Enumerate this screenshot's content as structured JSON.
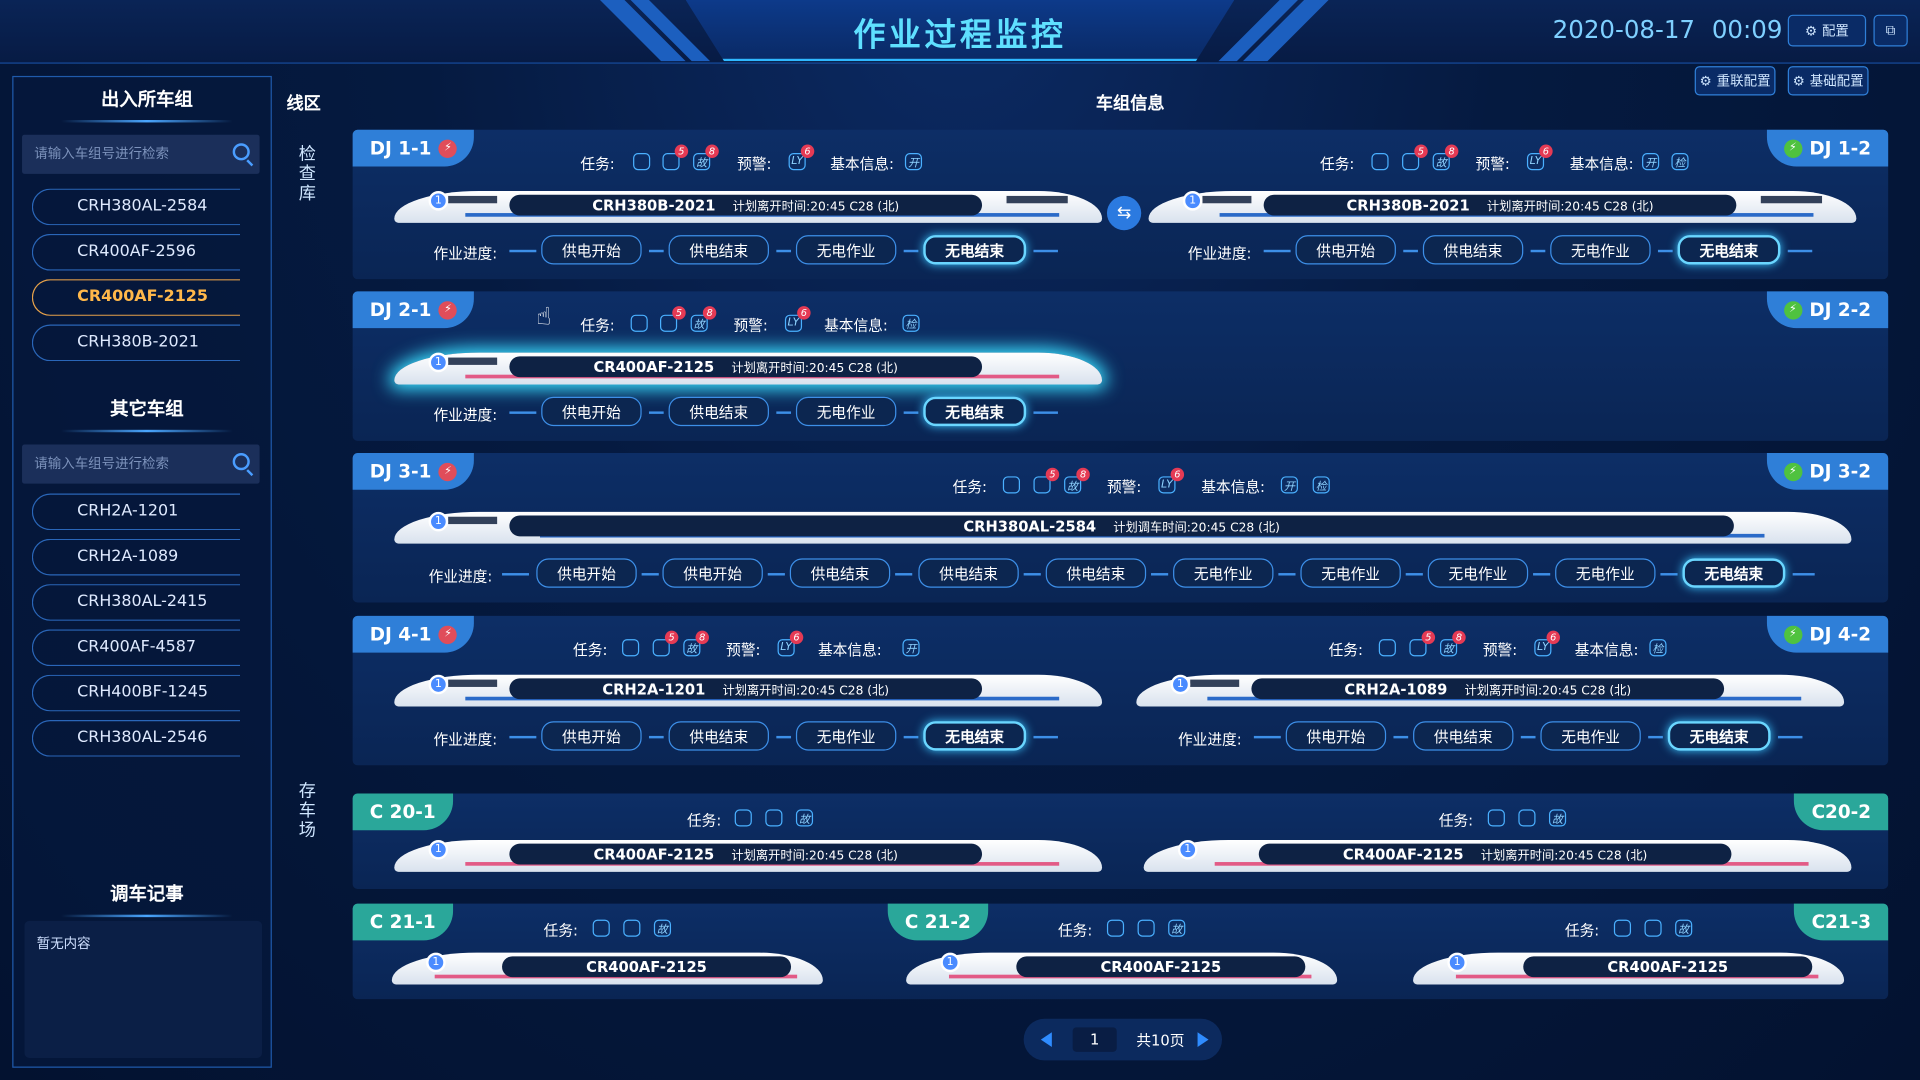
{
  "header": {
    "title": "作业过程监控",
    "date": "2020-08-17",
    "time": "00:09",
    "config": "配置",
    "reset_config": "重联配置",
    "base_config": "基础配置"
  },
  "left": {
    "in_out_title": "出入所车组",
    "search_placeholder": "请输入车组号进行检索",
    "in_out_list": [
      "CRH380AL-2584",
      "CR400AF-2596",
      "CR400AF-2125",
      "CRH380B-2021"
    ],
    "other_title": "其它车组",
    "other_list": [
      "CRH2A-1201",
      "CRH2A-1089",
      "CRH380AL-2415",
      "CR400AF-4587",
      "CRH400BF-1245",
      "CRH380AL-2546"
    ],
    "memo_title": "调车记事",
    "memo_content": "暂无内容"
  },
  "columns": {
    "zone": "线区",
    "info": "车组信息",
    "inspect": "检查库",
    "storage": "存车场"
  },
  "labels": {
    "task": "任务:",
    "warn": "预警:",
    "basic": "基本信息:",
    "progress": "作业进度:",
    "plan_leave": "计划离开时间:",
    "plan_shunt": "计划调车时间:",
    "time": "20:45 C28 (北)",
    "i_fault": "故",
    "i_warn": "LY",
    "i_open": "开",
    "i_check": "检",
    "b5": "5",
    "b8": "8",
    "b6": "6",
    "one": "1"
  },
  "rows": [
    {
      "left": "DJ 1-1",
      "right": "DJ 1-2",
      "train_l": "CRH380B-2021",
      "train_r": "CRH380B-2021"
    },
    {
      "left": "DJ 2-1",
      "right": "DJ 2-2",
      "train_l": "CR400AF-2125"
    },
    {
      "left": "DJ 3-1",
      "right": "DJ 3-2",
      "train_l": "CRH380AL-2584"
    },
    {
      "left": "DJ 4-1",
      "right": "DJ 4-2",
      "train_l": "CRH2A-1201",
      "train_r": "CRH2A-1089"
    },
    {
      "left": "C 20-1",
      "right": "C20-2",
      "train_l": "CR400AF-2125",
      "train_r": "CR400AF-2125"
    },
    {
      "left": "C 21-1",
      "mid": "C 21-2",
      "right": "C21-3",
      "t1": "CR400AF-2125",
      "t2": "CR400AF-2125",
      "t3": "CR400AF-2125"
    }
  ],
  "steps": {
    "s1": "供电开始",
    "s2": "供电结束",
    "s3": "无电作业",
    "s4": "无电结束"
  },
  "pager": {
    "page": "1",
    "total": "共10页"
  },
  "colors": {
    "accent": "#5fe0ff",
    "panel": "#0a2554",
    "tag_blue": "#2f7fd8",
    "tag_teal": "#2aa79a",
    "badge": "#e53a54"
  }
}
